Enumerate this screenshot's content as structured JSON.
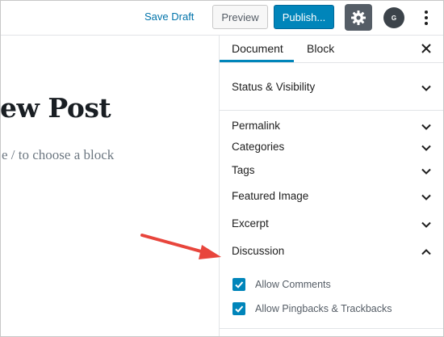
{
  "toolbar": {
    "save_draft": "Save Draft",
    "preview": "Preview",
    "publish": "Publish...",
    "settings_icon": "gear-icon",
    "avatar_initial": "G",
    "more_icon": "vertical-ellipsis-icon"
  },
  "editor": {
    "title_visible": "ew Post",
    "block_hint_visible": "e / to choose a block"
  },
  "sidebar": {
    "tabs": [
      {
        "label": "Document",
        "active": true
      },
      {
        "label": "Block",
        "active": false
      }
    ],
    "close_icon": "close-icon",
    "panels": [
      {
        "label": "Status & Visibility",
        "expanded": false
      },
      {
        "label": "Permalink",
        "expanded": false
      },
      {
        "label": "Categories",
        "expanded": false
      },
      {
        "label": "Tags",
        "expanded": false
      },
      {
        "label": "Featured Image",
        "expanded": false
      },
      {
        "label": "Excerpt",
        "expanded": false
      },
      {
        "label": "Discussion",
        "expanded": true
      }
    ],
    "discussion_options": [
      {
        "label": "Allow Comments",
        "checked": true
      },
      {
        "label": "Allow Pingbacks & Trackbacks",
        "checked": true
      }
    ]
  },
  "colors": {
    "accent": "#0085ba",
    "link": "#0073aa",
    "annotation_arrow": "#e8453c"
  }
}
